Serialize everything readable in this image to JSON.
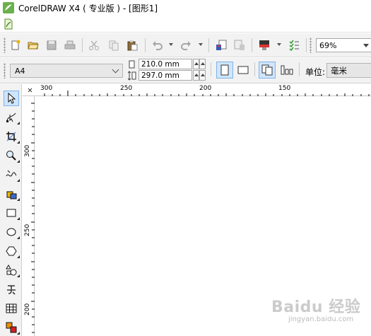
{
  "window": {
    "title": "CorelDRAW X4 ( 专业版 ) - [图形1]"
  },
  "toolbar": {
    "zoom_value": "69%"
  },
  "property_bar": {
    "paper_size": "A4",
    "width": "210.0 mm",
    "height": "297.0 mm",
    "unit_label": "单位:",
    "unit_value": "毫米"
  },
  "ruler": {
    "horizontal_labels": [
      "300",
      "250",
      "200",
      "150"
    ],
    "vertical_labels": [
      "300",
      "250",
      "200"
    ]
  },
  "watermark": {
    "logo": "Baidu 经验",
    "url": "jingyan.baidu.com"
  },
  "colors": {
    "toolbar_bg": "#f2f2f2",
    "active_blue": "#cfe5fb",
    "active_border": "#7eb4ea",
    "title_green": "#6ab04c"
  }
}
